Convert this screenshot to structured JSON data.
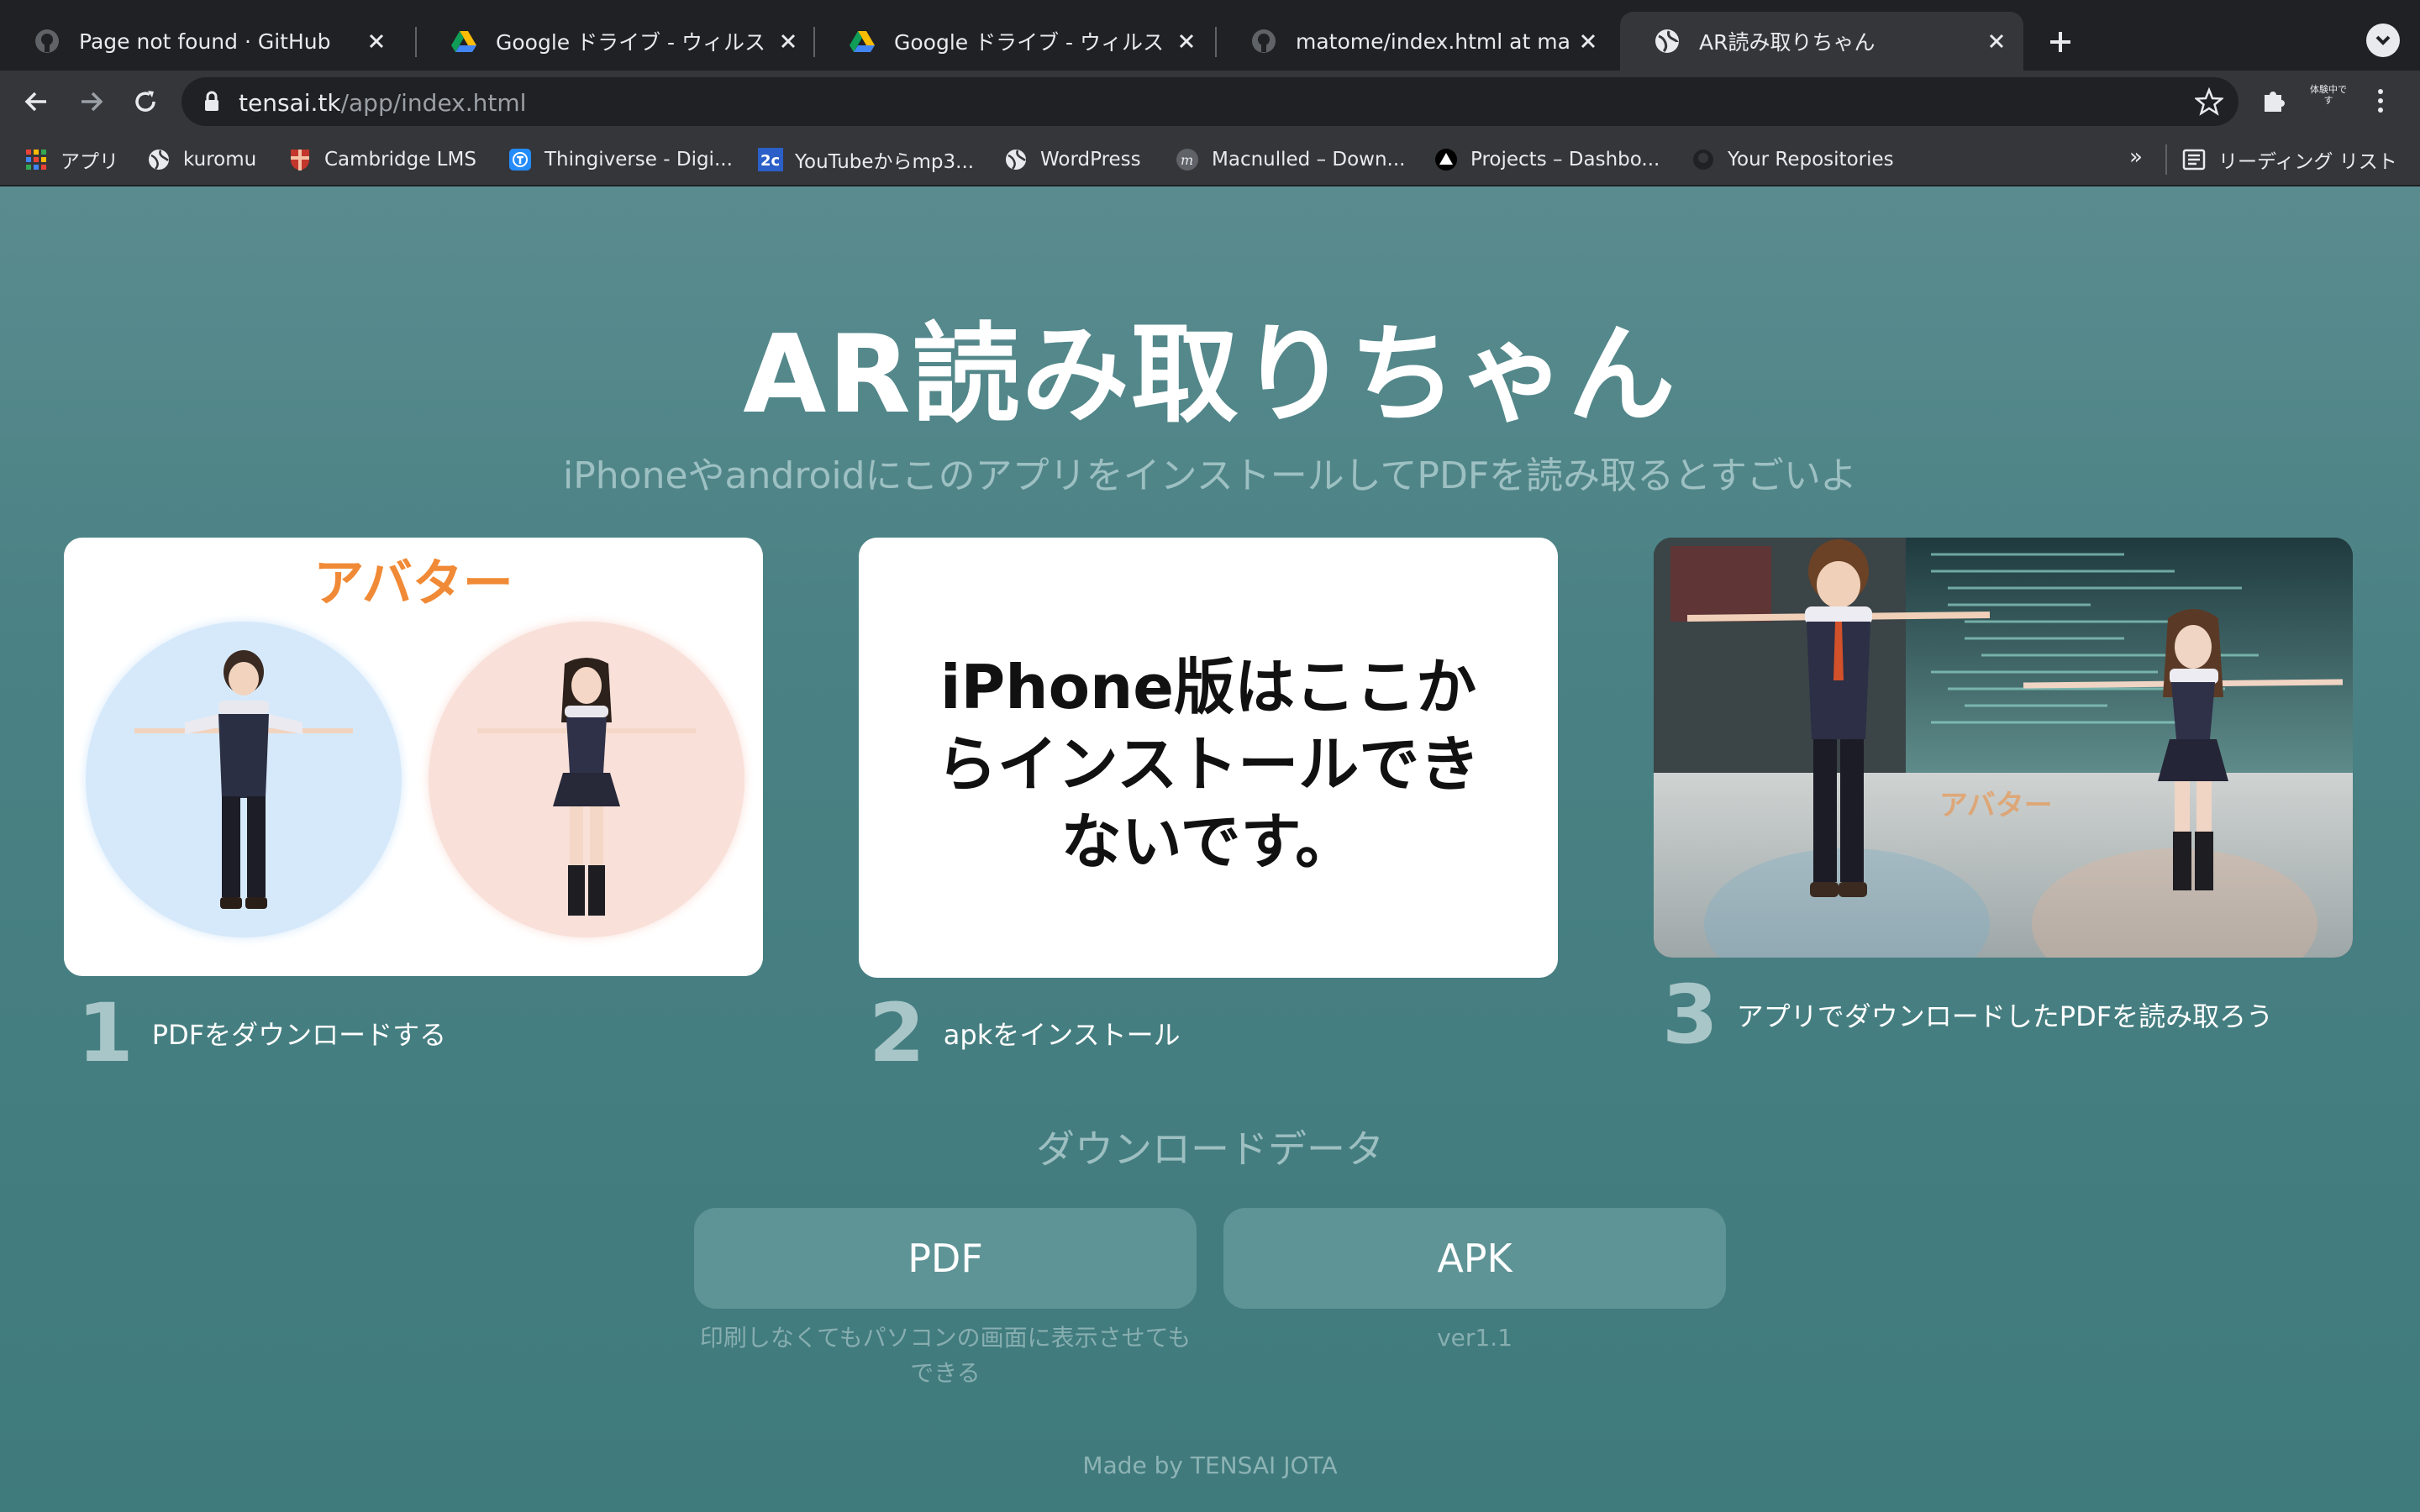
{
  "browser": {
    "tabs": [
      {
        "title": "Page not found · GitHub",
        "icon": "github-icon",
        "active": false
      },
      {
        "title": "Google ドライブ - ウィルス スキャン",
        "icon": "google-drive-icon",
        "active": false
      },
      {
        "title": "Google ドライブ - ウィルス スキャン",
        "icon": "google-drive-icon",
        "active": false
      },
      {
        "title": "matome/index.html at main · jota",
        "icon": "github-icon",
        "active": false
      },
      {
        "title": "AR読み取りちゃん",
        "icon": "globe-icon",
        "active": true
      }
    ],
    "url": {
      "host": "tensai.tk",
      "path": "/app/index.html"
    },
    "profile_ext_label": "体験中です",
    "bookmarks": [
      {
        "label": "アプリ",
        "icon": "apps-grid-icon"
      },
      {
        "label": "kuromu",
        "icon": "globe-icon"
      },
      {
        "label": "Cambridge LMS",
        "icon": "cambridge-shield-icon"
      },
      {
        "label": "Thingiverse - Digi...",
        "icon": "thingiverse-icon"
      },
      {
        "label": "YouTubeからmp3...",
        "icon": "2c-icon"
      },
      {
        "label": "WordPress",
        "icon": "globe-icon"
      },
      {
        "label": "Macnulled – Down...",
        "icon": "macnulled-icon"
      },
      {
        "label": "Projects – Dashbo...",
        "icon": "vercel-triangle-icon"
      },
      {
        "label": "Your Repositories",
        "icon": "github-icon"
      }
    ],
    "bookmarks_more": "»",
    "reading_list": "リーディング リスト"
  },
  "page": {
    "title": "AR読み取りちゃん",
    "subtitle": "iPhoneやandroidにこのアプリをインストールしてPDFを読み取るとすごいよ",
    "card1": {
      "heading": "アバター"
    },
    "card2": {
      "text": "iPhone版はここからインストールできないです。"
    },
    "steps": [
      {
        "num": "1",
        "label": "PDFをダウンロードする"
      },
      {
        "num": "2",
        "label": "apkをインストール"
      },
      {
        "num": "3",
        "label": "アプリでダウンロードしたPDFを読み取ろう"
      }
    ],
    "download": {
      "heading": "ダウンロードデータ",
      "pdf_button": "PDF",
      "pdf_note": "印刷しなくてもパソコンの画面に表示させてもできる",
      "apk_button": "APK",
      "apk_note": "ver1.1"
    },
    "footer": "Made by TENSAI JOTA",
    "colors": {
      "background": "#4a8184",
      "accent": "#f08a36",
      "button": "#5e9496"
    }
  }
}
